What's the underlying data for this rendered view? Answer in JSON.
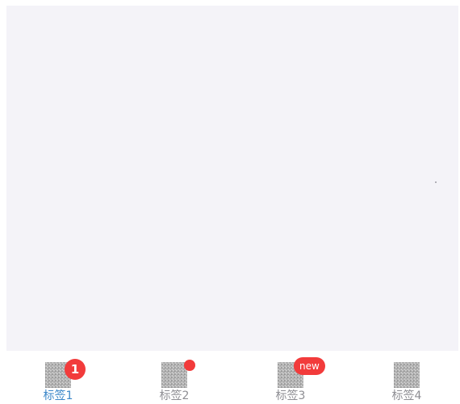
{
  "content": {
    "background": "#f4f3f8"
  },
  "tabbar": {
    "active_color": "#3a86c8",
    "inactive_color": "#8e8e93",
    "badge_color": "#f23b3b",
    "tabs": [
      {
        "label": "标签1",
        "icon": "placeholder-image-icon",
        "badge": "1",
        "active": true
      },
      {
        "label": "标签2",
        "icon": "placeholder-image-icon",
        "badge_dot": true
      },
      {
        "label": "标签3",
        "icon": "placeholder-image-icon",
        "badge": "new"
      },
      {
        "label": "标签4",
        "icon": "placeholder-image-icon"
      }
    ]
  }
}
